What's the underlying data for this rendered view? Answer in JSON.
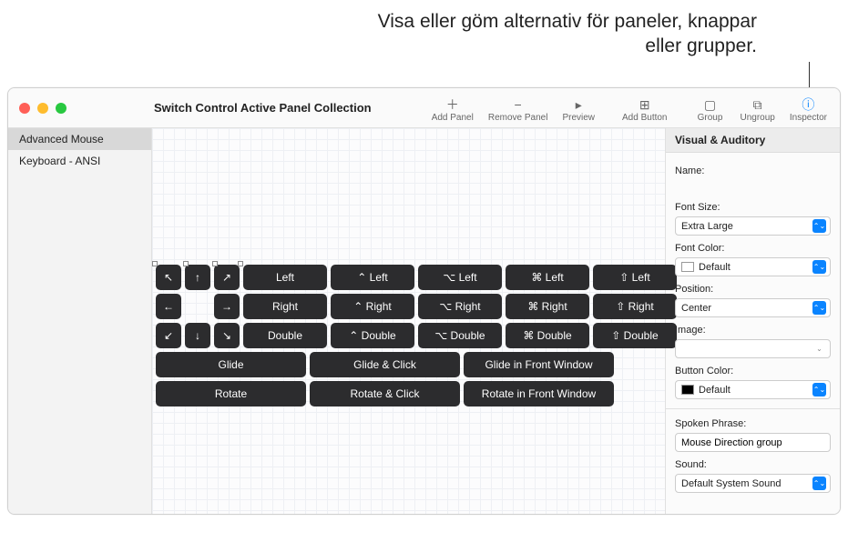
{
  "annotation": "Visa eller göm alternativ för paneler, knappar eller grupper.",
  "window_title": "Switch Control Active Panel Collection",
  "toolbar": {
    "add_panel": "Add Panel",
    "remove_panel": "Remove Panel",
    "preview": "Preview",
    "add_button": "Add Button",
    "group": "Group",
    "ungroup": "Ungroup",
    "inspector": "Inspector"
  },
  "sidebar": {
    "items": [
      {
        "label": "Advanced Mouse",
        "selected": true
      },
      {
        "label": "Keyboard - ANSI",
        "selected": false
      }
    ]
  },
  "panel": {
    "arrows": {
      "nw": "↖",
      "n": "↑",
      "ne": "↗",
      "w": "←",
      "e": "→",
      "sw": "↙",
      "s": "↓",
      "se": "↘"
    },
    "rows": [
      [
        "Left",
        "⌃ Left",
        "⌥ Left",
        "⌘ Left",
        "⇧ Left"
      ],
      [
        "Right",
        "⌃ Right",
        "⌥ Right",
        "⌘ Right",
        "⇧ Right"
      ],
      [
        "Double",
        "⌃ Double",
        "⌥ Double",
        "⌘ Double",
        "⇧ Double"
      ]
    ],
    "wide": [
      [
        "Glide",
        "Glide & Click",
        "Glide in Front Window"
      ],
      [
        "Rotate",
        "Rotate & Click",
        "Rotate in Front Window"
      ]
    ]
  },
  "inspector": {
    "header": "Visual & Auditory",
    "name_label": "Name:",
    "name_value": "",
    "font_size_label": "Font Size:",
    "font_size_value": "Extra Large",
    "font_color_label": "Font Color:",
    "font_color_value": "Default",
    "position_label": "Position:",
    "position_value": "Center",
    "image_label": "Image:",
    "image_value": "",
    "button_color_label": "Button Color:",
    "button_color_value": "Default",
    "spoken_label": "Spoken Phrase:",
    "spoken_value": "Mouse Direction group",
    "sound_label": "Sound:",
    "sound_value": "Default System Sound"
  }
}
